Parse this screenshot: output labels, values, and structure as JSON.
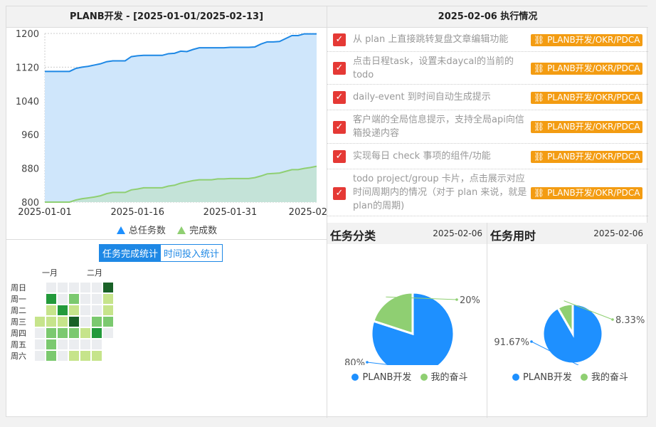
{
  "left_panel": {
    "title": "PLANB开发 - [2025-01-01/2025-02-13]",
    "legend": [
      "总任务数",
      "完成数"
    ],
    "tabs": [
      "任务完成统计",
      "时间投入统计"
    ],
    "months": [
      "一月",
      "二月"
    ],
    "weekdays": [
      "周日",
      "周一",
      "周二",
      "周三",
      "周四",
      "周五",
      "周六"
    ]
  },
  "chart_data": {
    "type": "area",
    "x_ticks": [
      "2025-01-01",
      "2025-01-16",
      "2025-01-31",
      "2025-02"
    ],
    "y_ticks": [
      800,
      880,
      960,
      1040,
      1120,
      1200
    ],
    "ylim": [
      800,
      1200
    ],
    "series": [
      {
        "name": "总任务数",
        "color": "#1e88e5",
        "values": [
          1110,
          1110,
          1110,
          1110,
          1110,
          1117,
          1120,
          1122,
          1125,
          1128,
          1133,
          1135,
          1135,
          1135,
          1145,
          1147,
          1148,
          1148,
          1148,
          1148,
          1152,
          1153,
          1158,
          1157,
          1162,
          1166,
          1166,
          1166,
          1166,
          1166,
          1167,
          1167,
          1167,
          1167,
          1168,
          1175,
          1180,
          1180,
          1181,
          1188,
          1195,
          1195,
          1199,
          1199,
          1199
        ]
      },
      {
        "name": "完成数",
        "color": "#8fcf72",
        "values": [
          800,
          800,
          800,
          800,
          800,
          805,
          808,
          810,
          812,
          815,
          820,
          823,
          823,
          823,
          829,
          831,
          834,
          834,
          834,
          834,
          838,
          840,
          845,
          848,
          851,
          853,
          853,
          853,
          855,
          855,
          856,
          856,
          856,
          856,
          858,
          862,
          867,
          868,
          869,
          873,
          877,
          877,
          880,
          882,
          885
        ]
      }
    ]
  },
  "heatmap": {
    "colors": [
      "#ebedf0",
      "#c6e48b",
      "#7bc96f",
      "#239a3b",
      "#196127"
    ],
    "weeks": [
      [
        null,
        null,
        null,
        1,
        0,
        0,
        0
      ],
      [
        0,
        3,
        1,
        1,
        2,
        2,
        2
      ],
      [
        0,
        0,
        3,
        1,
        2,
        0,
        0
      ],
      [
        0,
        2,
        1,
        4,
        2,
        0,
        1
      ],
      [
        0,
        0,
        0,
        0,
        1,
        0,
        1
      ],
      [
        0,
        0,
        0,
        2,
        3,
        0,
        1
      ],
      [
        4,
        1,
        1,
        2,
        0,
        null,
        null
      ]
    ]
  },
  "right_panel": {
    "title": "2025-02-06 执行情况",
    "tasks": [
      {
        "text": "从 plan 上直接跳转复盘文章编辑功能",
        "tag": "PLANB开发/OKR/PDCA"
      },
      {
        "text": "点击日程task，设置未daycal的当前的todo",
        "tag": "PLANB开发/OKR/PDCA"
      },
      {
        "text": "daily-event 到时间自动生成提示",
        "tag": "PLANB开发/OKR/PDCA"
      },
      {
        "text": "客户端的全局信息提示，支持全局api向信箱投递内容",
        "tag": "PLANB开发/OKR/PDCA"
      },
      {
        "text": "实现每日 check 事项的组件/功能",
        "tag": "PLANB开发/OKR/PDCA"
      },
      {
        "text": "todo project/group 卡片，点击展示对应时间周期内的情况（对于 plan 来说，就是plan的周期)",
        "tag": "PLANB开发/OKR/PDCA"
      }
    ]
  },
  "pie_category": {
    "title": "任务分类",
    "date": "2025-02-06",
    "slices": [
      {
        "name": "PLANB开发",
        "value": 80,
        "label": "80%",
        "color": "#1e90ff"
      },
      {
        "name": "我的奋斗",
        "value": 20,
        "label": "20%",
        "color": "#8fcf72"
      }
    ]
  },
  "pie_time": {
    "title": "任务用时",
    "date": "2025-02-06",
    "slices": [
      {
        "name": "PLANB开发",
        "value": 91.67,
        "label": "91.67%",
        "color": "#1e90ff"
      },
      {
        "name": "我的奋斗",
        "value": 8.33,
        "label": "8.33%",
        "color": "#8fcf72"
      }
    ]
  }
}
